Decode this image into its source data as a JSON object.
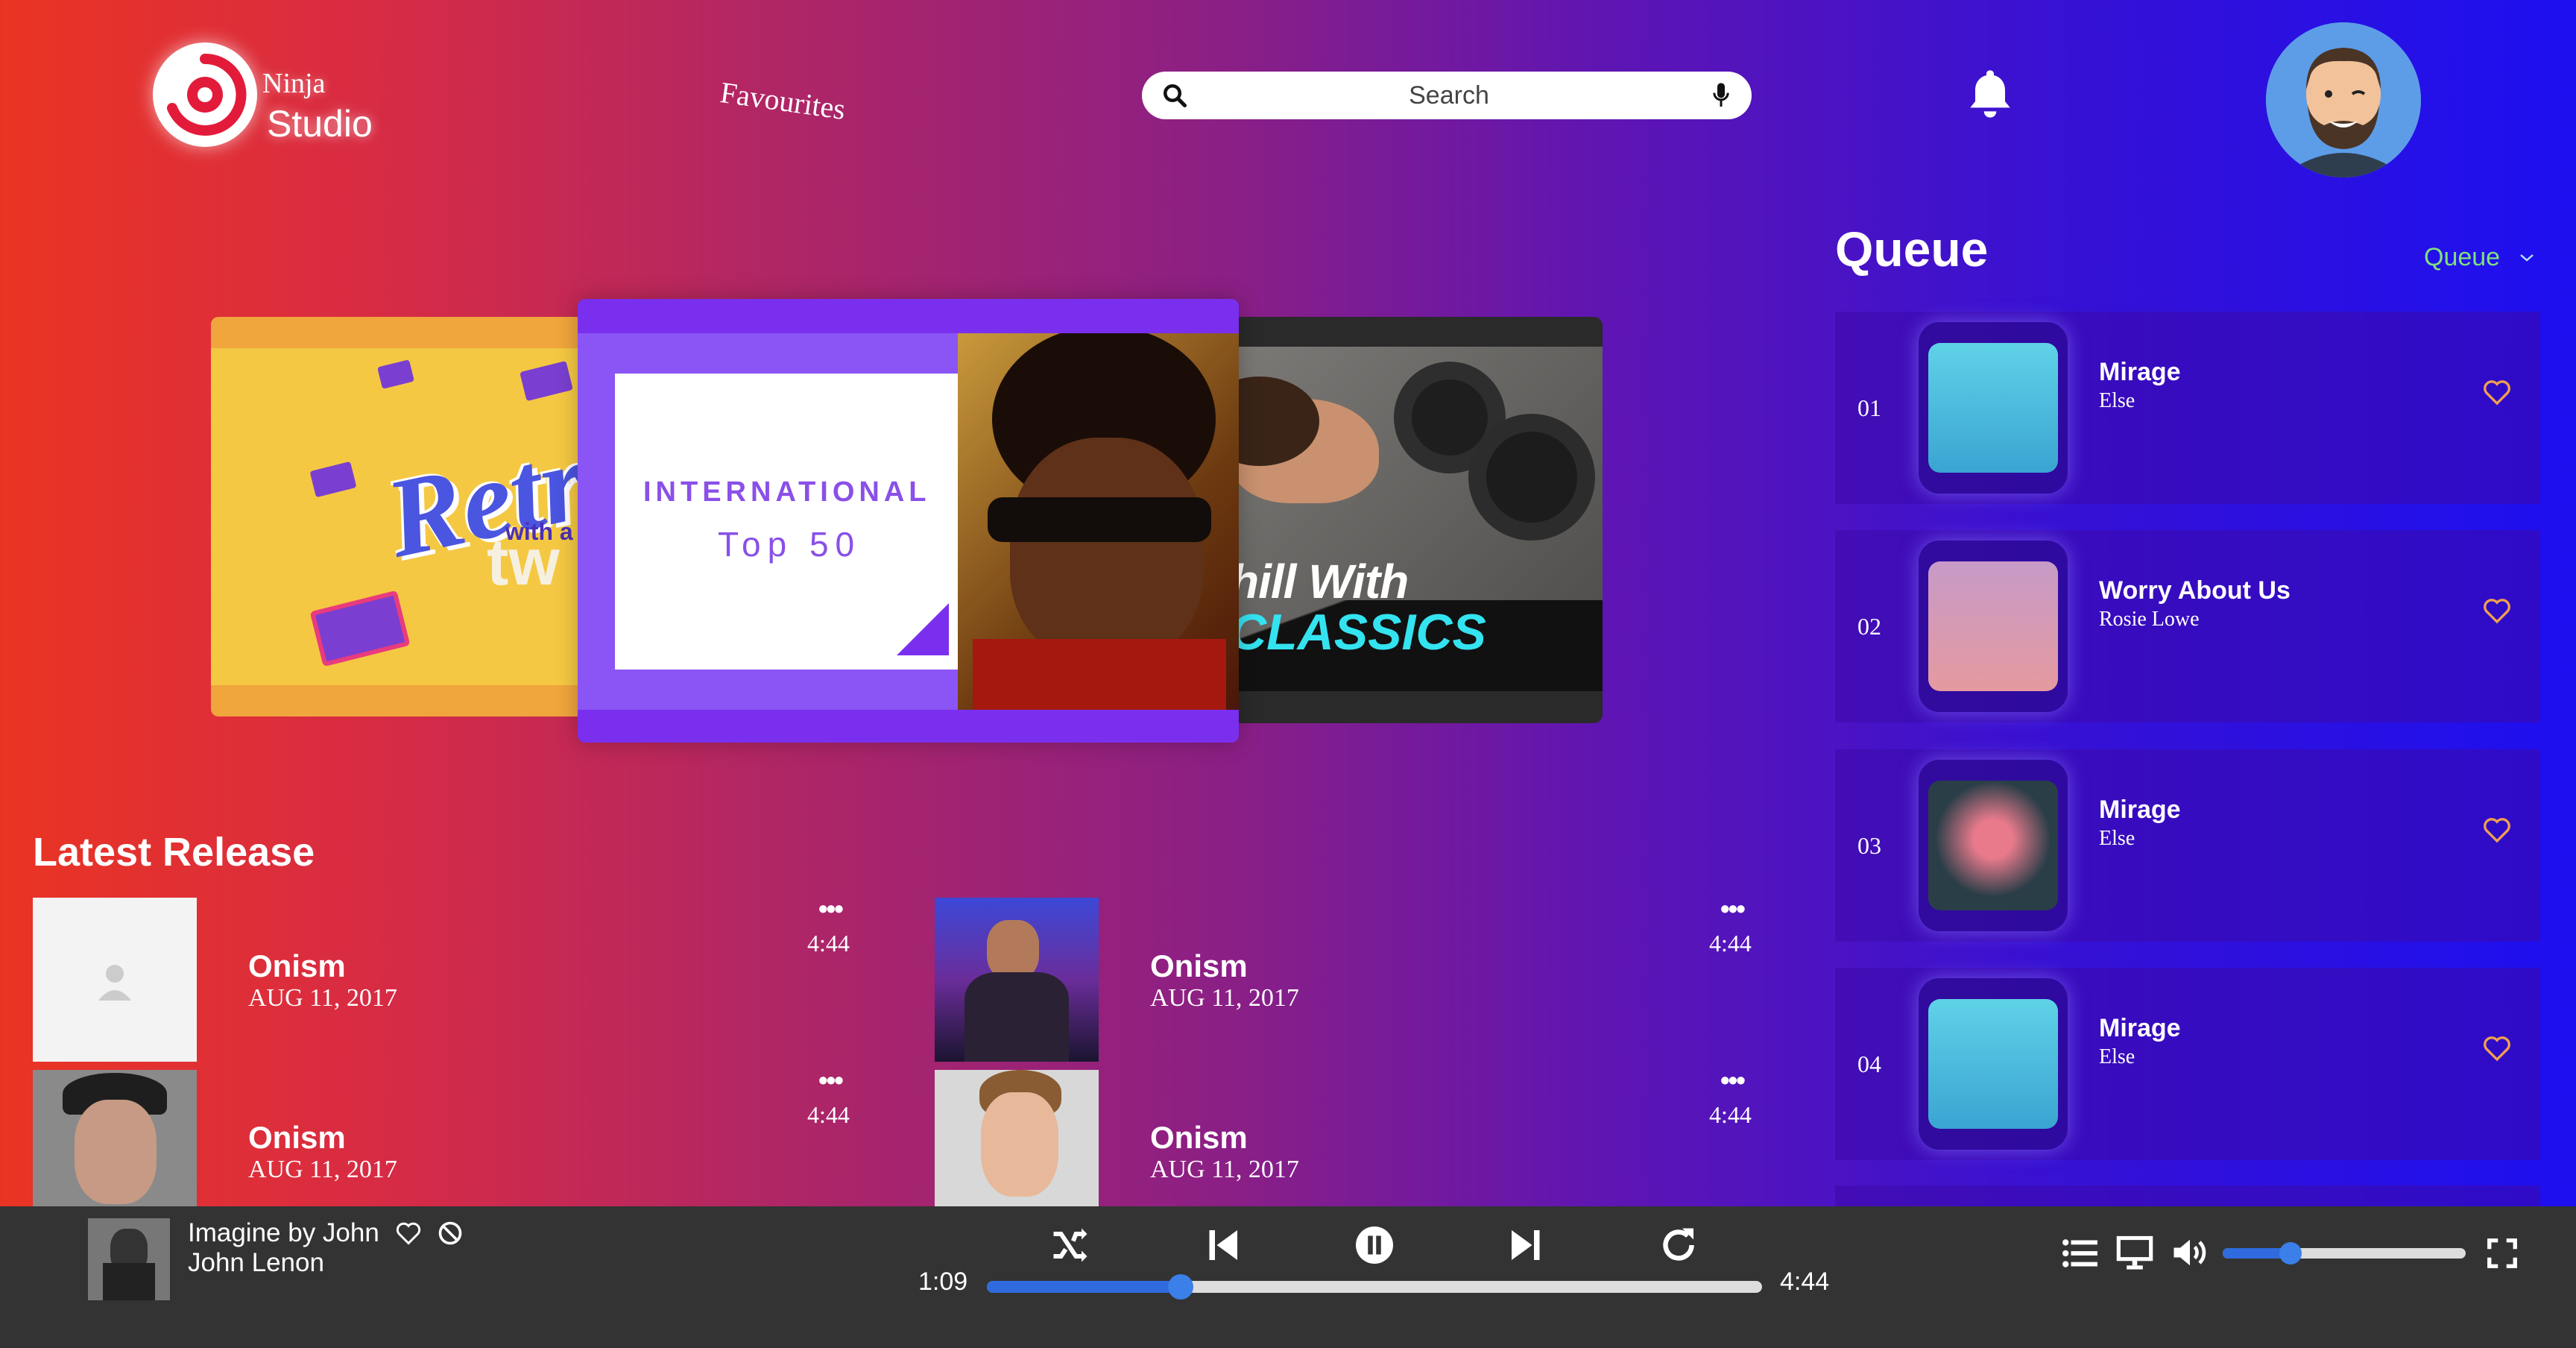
{
  "header": {
    "logo_line1": "Ninja",
    "logo_line2": "Studio",
    "nav_favourites": "Favourites",
    "search_placeholder": "Search"
  },
  "carousel": {
    "cards": [
      {
        "name": "Retro with a twist",
        "text_top": "Retr",
        "text_mid": "with a",
        "text_bot": "tw"
      },
      {
        "name": "International Top 50",
        "text_top": "INTERNATIONAL",
        "text_bot": "Top 50"
      },
      {
        "name": "Chill With Classics",
        "text_top": "hill With",
        "text_bot": "CLASSICS"
      }
    ]
  },
  "latest_release": {
    "title": "Latest Release",
    "items": [
      {
        "name": "Onism",
        "date": "AUG 11, 2017",
        "duration": "4:44",
        "more": "•••"
      },
      {
        "name": "Onism",
        "date": "AUG 11, 2017",
        "duration": "4:44",
        "more": "•••"
      },
      {
        "name": "Onism",
        "date": "AUG 11, 2017",
        "duration": "4:44",
        "more": "•••"
      },
      {
        "name": "Onism",
        "date": "AUG 11, 2017",
        "duration": "4:44",
        "more": "•••"
      }
    ]
  },
  "queue": {
    "title": "Queue",
    "selector_label": "Queue",
    "items": [
      {
        "num": "01",
        "title": "Mirage",
        "artist": "Else"
      },
      {
        "num": "02",
        "title": "Worry About Us",
        "artist": "Rosie Lowe"
      },
      {
        "num": "03",
        "title": "Mirage",
        "artist": "Else"
      },
      {
        "num": "04",
        "title": "Mirage",
        "artist": "Else"
      }
    ]
  },
  "player": {
    "title": "Imagine by John",
    "artist": "John Lenon",
    "elapsed": "1:09",
    "total": "4:44",
    "progress_fraction": 0.25,
    "volume_fraction": 0.28
  },
  "colors": {
    "accent_blue": "#2f6bde",
    "queue_select_green": "#7fe07f",
    "heart_orange": "#f0a050",
    "player_bg": "#333333"
  },
  "icons": [
    "logo-icon",
    "search-icon",
    "microphone-icon",
    "bell-icon",
    "heart-icon",
    "block-icon",
    "shuffle-icon",
    "previous-icon",
    "pause-icon",
    "next-icon",
    "repeat-icon",
    "queue-list-icon",
    "screen-icon",
    "volume-icon",
    "fullscreen-icon",
    "chevron-down-icon",
    "more-icon"
  ]
}
